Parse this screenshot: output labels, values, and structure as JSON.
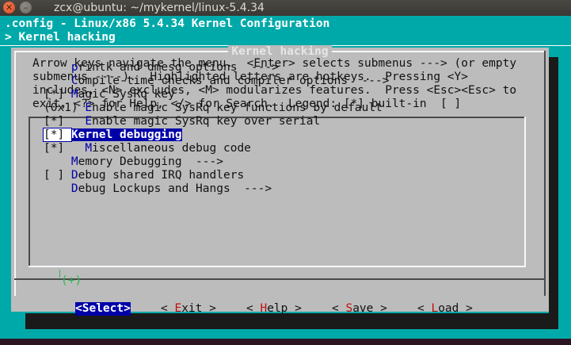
{
  "window": {
    "title": "zcx@ubuntu: ~/mykernel/linux-5.4.34",
    "close_glyph": "✕",
    "min_glyph": "–"
  },
  "terminal": {
    "header_line": ".config - Linux/x86 5.4.34 Kernel Configuration",
    "breadcrumb": "> Kernel hacking"
  },
  "dialog": {
    "title": "Kernel hacking",
    "help_lines": [
      "Arrow keys navigate the menu.  <Enter> selects submenus ---> (or empty",
      "submenus ----).  Highlighted letters are hotkeys.  Pressing <Y>",
      "includes, <N> excludes, <M> modularizes features.  Press <Esc><Esc> to",
      "exit, <?> for Help, </> for Search.  Legend: [*] built-in  [ ]"
    ]
  },
  "menu": {
    "items": [
      {
        "prefix": "    ",
        "hot": "p",
        "rest": "rintk and dmesg options  --->"
      },
      {
        "prefix": "    ",
        "hot": "C",
        "rest": "ompile-time checks and compiler options  --->"
      },
      {
        "prefix": "[*] ",
        "hot": "M",
        "rest": "agic SysRq key"
      },
      {
        "prefix": "(0x1) ",
        "hot": "E",
        "rest": "nable magic SysRq key functions by default"
      },
      {
        "prefix": "[*]   ",
        "hot": "E",
        "rest": "nable magic SysRq key over serial"
      },
      {
        "prefix": "[*] ",
        "hot": "K",
        "rest": "ernel debugging",
        "selected": true
      },
      {
        "prefix": "[*]   ",
        "hot": "M",
        "rest": "iscellaneous debug code"
      },
      {
        "prefix": "    ",
        "hot": "M",
        "rest": "emory Debugging  --->"
      },
      {
        "prefix": "[ ] ",
        "hot": "D",
        "rest": "ebug shared IRQ handlers"
      },
      {
        "prefix": "    ",
        "hot": "D",
        "rest": "ebug Lockups and Hangs  --->"
      }
    ],
    "more_indicator": "(+)"
  },
  "buttons": {
    "select": {
      "open": "<",
      "hot": "S",
      "rest": "elect",
      "close": ">"
    },
    "exit": {
      "open": "< ",
      "hot": "E",
      "rest": "xit",
      "close": " >"
    },
    "help": {
      "open": "< ",
      "hot": "H",
      "rest": "elp",
      "close": " >"
    },
    "save": {
      "open": "< ",
      "hot": "S",
      "rest": "ave",
      "close": " >"
    },
    "load": {
      "open": "< ",
      "hot": "L",
      "rest": "oad",
      "close": " >"
    }
  },
  "colors": {
    "terminal_bg": "#00a9a9",
    "dialog_bg": "#bcbcbc",
    "selection_bg": "#0000a8",
    "hotkey_menu": "#0000a8",
    "hotkey_button": "#c01010",
    "more_indicator": "#2fb84a"
  }
}
